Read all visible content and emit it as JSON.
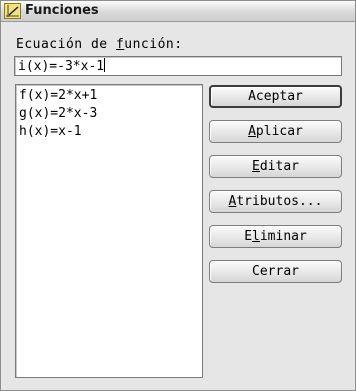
{
  "window": {
    "title": "Funciones",
    "icon": "function-graph-icon"
  },
  "equation": {
    "label_prefix": "Ecuaci",
    "label_mid": "ón de ",
    "label_accel": "f",
    "label_suffix": "unción:",
    "value": "i(x)=-3*x-1"
  },
  "functions": [
    "f(x)=2*x+1",
    "g(x)=2*x-3",
    "h(x)=x-1"
  ],
  "buttons": {
    "accept": "Aceptar",
    "apply_accel": "A",
    "apply_rest": "plicar",
    "edit_accel": "E",
    "edit_rest": "ditar",
    "attributes_accel": "A",
    "attributes_rest": "tributos...",
    "delete_pre": "E",
    "delete_accel": "l",
    "delete_rest": "iminar",
    "close": "Cerrar"
  }
}
